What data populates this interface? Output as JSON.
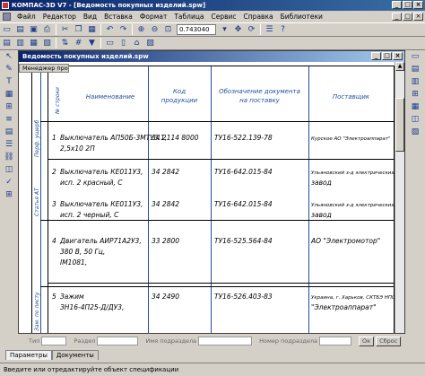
{
  "window": {
    "title": "КОМПАС-3D V7 - [Ведомость покупных изделий.spw]",
    "colors": {
      "titlebar_start": "#0a246a",
      "titlebar_end": "#3a6ea5",
      "spec_line": "#1f4e9a"
    }
  },
  "menu": {
    "items": [
      "Файл",
      "Редактор",
      "Вид",
      "Вставка",
      "Формат",
      "Таблица",
      "Сервис",
      "Справка",
      "Библиотеки"
    ]
  },
  "toolbar": {
    "zoom_value": "0.743040",
    "icons": [
      "new-icon",
      "open-icon",
      "save-icon",
      "print-icon",
      "cut-icon",
      "copy-icon",
      "paste-icon",
      "undo-icon",
      "redo-icon",
      "zoom-in-icon",
      "zoom-out-icon",
      "zoom-window-icon",
      "pan-icon",
      "refresh-icon",
      "properties-icon",
      "help-icon"
    ]
  },
  "document": {
    "title": "Ведомость покупных изделий.spw",
    "manager_tab": "Менеджер проекта"
  },
  "spec": {
    "headers": {
      "num": "№ строки",
      "name": "Наименование",
      "code": "Код\nпродукции",
      "doc": "Обозначение документа\nна поставку",
      "supplier": "Поставщик"
    },
    "groups": [
      "Перф. ущерб",
      "Статья АТ",
      "Зам. по листу"
    ],
    "rows": [
      {
        "num": "1",
        "name_lines": [
          "Выключатель АП50Б-3МТУ3.1,",
          "2,5х10 2П"
        ],
        "code": "34 2114 8000",
        "doc": "ТУ16-522.139-78",
        "supplier_lines": [
          "Курское АО \"Электроаппарат\""
        ]
      },
      {
        "num": "2",
        "name_lines": [
          "Выключатель КЕ011У3,",
          "исп. 2 красный, С"
        ],
        "code": "34 2842",
        "doc": "ТУ16-642.015-84",
        "supplier_lines": [
          "Ульяновский з-д электрических",
          "завод"
        ]
      },
      {
        "num": "3",
        "name_lines": [
          "Выключатель КЕ011У3,",
          "исп. 2 черный, С"
        ],
        "code": "34 2842",
        "doc": "ТУ16-642.015-84",
        "supplier_lines": [
          "Ульяновский з-д электрических",
          "завод"
        ]
      },
      {
        "num": "4",
        "name_lines": [
          "Двигатель АИР71А2У3,",
          "380 В, 50 Гц,",
          "IМ1081,"
        ],
        "code": "33 2800",
        "doc": "ТУ16-525.564-84",
        "supplier_lines": [
          "АО \"Электромотор\""
        ]
      },
      {
        "num": "5",
        "name_lines": [
          "Зажим",
          "ЗН16-4П25-Д/ДУ3,"
        ],
        "code": "34 2490",
        "doc": "ТУ16-526.403-83",
        "supplier_lines": [
          "Украина, г. Харьков, СКТБЭ НПО",
          "\"Электроаппарат\""
        ]
      }
    ]
  },
  "param_bar": {
    "fields": [
      "Тип",
      "Раздел",
      "Имя подраздела",
      "Номер подраздела"
    ],
    "ok_label": "Ок",
    "cancel_label": "Сброс"
  },
  "tabs": [
    "Параметры",
    "Документы"
  ],
  "status": "Введите или отредактируйте объект спецификации"
}
